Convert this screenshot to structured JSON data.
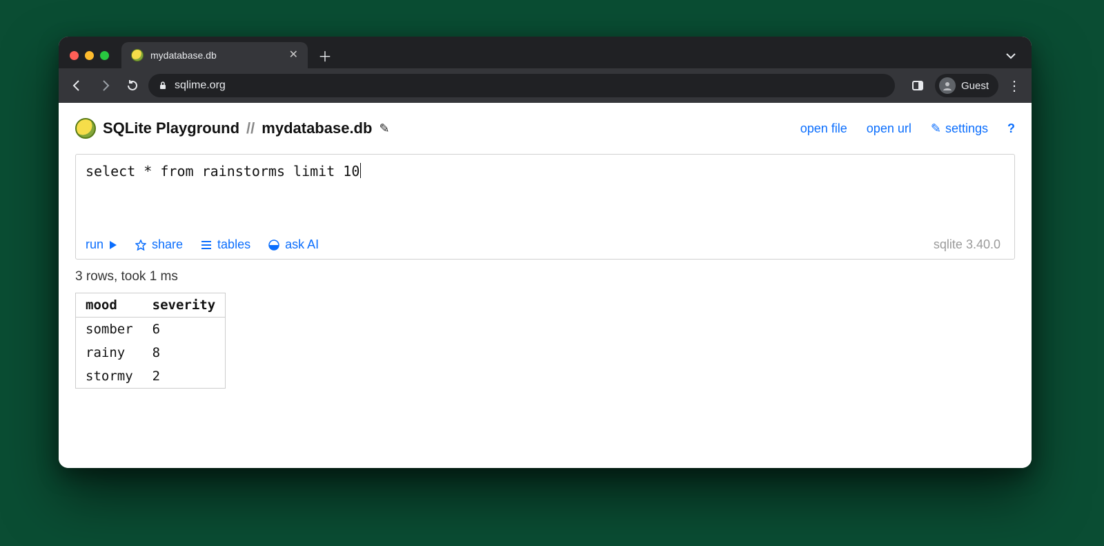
{
  "browser": {
    "tab_title": "mydatabase.db",
    "url": "sqlime.org",
    "guest_label": "Guest"
  },
  "header": {
    "app_title": "SQLite Playground",
    "separator": "//",
    "db_name": "mydatabase.db",
    "links": {
      "open_file": "open file",
      "open_url": "open url",
      "settings": "settings",
      "help": "?"
    }
  },
  "editor": {
    "query": "select * from rainstorms limit 10",
    "actions": {
      "run": "run",
      "share": "share",
      "tables": "tables",
      "ask_ai": "ask AI"
    },
    "sqlite_version": "sqlite 3.40.0"
  },
  "result": {
    "status": "3 rows, took 1 ms",
    "columns": [
      "mood",
      "severity"
    ],
    "rows": [
      {
        "mood": "somber",
        "severity": "6"
      },
      {
        "mood": "rainy",
        "severity": "8"
      },
      {
        "mood": "stormy",
        "severity": "2"
      }
    ]
  }
}
